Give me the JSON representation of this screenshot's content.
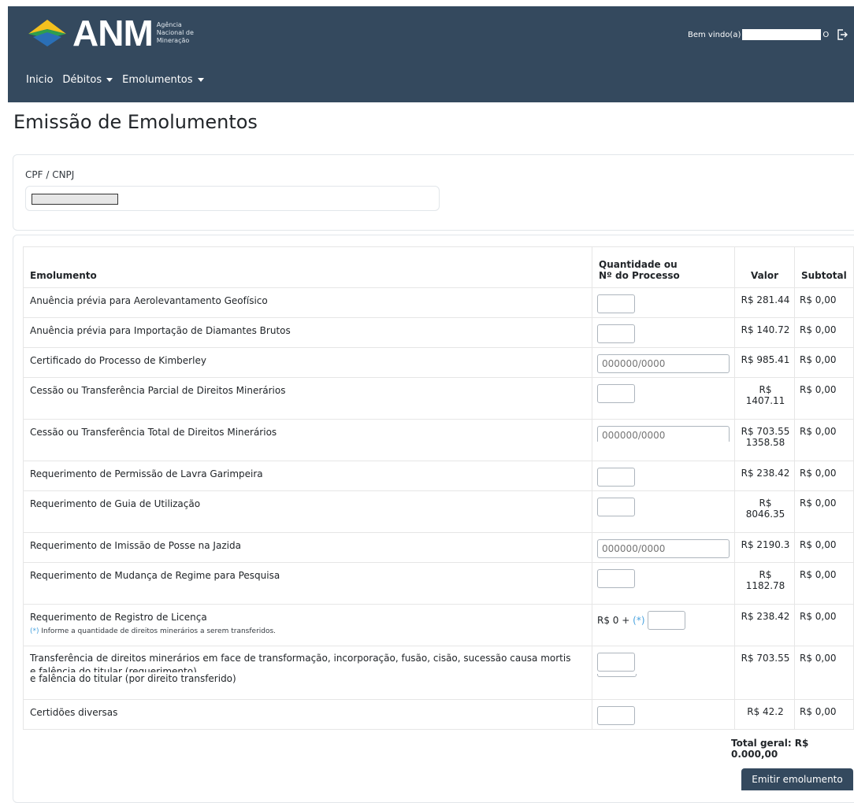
{
  "header": {
    "logo_text": "ANM",
    "logo_sub": [
      "Agência",
      "Nacional de",
      "Mineração"
    ],
    "welcome": "Bem vindo(a)",
    "welcome_tail": "O",
    "nav": [
      "Inicio",
      "Débitos",
      "Emolumentos"
    ],
    "colors": {
      "topbar": "#34495e",
      "logo_yellow": "#f4c01e",
      "logo_green": "#2e9e4f",
      "logo_blue": "#2a6fb6"
    }
  },
  "page": {
    "title": "Emissão de Emolumentos"
  },
  "cpf": {
    "label": "CPF / CNPJ"
  },
  "table": {
    "headers": {
      "emolumento": "Emolumento",
      "qty_line1": "Quantidade ou",
      "qty_line2": "Nº do Processo",
      "valor": "Valor",
      "subtotal": "Subtotal"
    },
    "process_placeholder": "000000/0000",
    "rows": [
      {
        "name": "Anuência prévia para Aerolevantamento Geofísico",
        "valor": "R$ 281.44",
        "subtotal": "R$ 0,00"
      },
      {
        "name": "Anuência prévia para Importação de Diamantes Brutos",
        "valor": "R$ 140.72",
        "subtotal": "R$ 0,00"
      },
      {
        "name": "Certificado do Processo de Kimberley",
        "valor": "R$ 985.41",
        "subtotal": "R$ 0,00"
      },
      {
        "name": "Cessão ou Transferência Parcial de Direitos Minerários",
        "valor_1": "R$",
        "valor_2": "1407.11",
        "subtotal": "R$ 0,00"
      },
      {
        "name": "Cessão ou Transferência Total de Direitos Minerários",
        "valor_1": "R$ 703.55",
        "valor_2": "1358.58",
        "subtotal": "R$ 0,00"
      },
      {
        "name": "Requerimento de Permissão de Lavra Garimpeira",
        "valor": "R$ 238.42",
        "subtotal": "R$ 0,00"
      },
      {
        "name": "Requerimento de Guia de Utilização",
        "valor_1": "R$",
        "valor_2": "8046.35",
        "subtotal": "R$ 0,00"
      },
      {
        "name": "Requerimento de Imissão de Posse na Jazida",
        "valor": "R$ 2190.3",
        "subtotal": "R$ 0,00"
      },
      {
        "name": "Requerimento de Mudança de Regime para Pesquisa",
        "valor_1": "R$",
        "valor_2": "1182.78",
        "subtotal": "R$ 0,00"
      },
      {
        "name": "Requerimento de Registro de Licença",
        "note_ast": "(*)",
        "note": "Informe a quantidade de direitos minerários a serem transferidos.",
        "prefix": "R$ 0 +",
        "prefix_ast": "(*)",
        "valor": "R$ 238.42",
        "subtotal": "R$ 0,00"
      },
      {
        "name_1": "Transferência de direitos minerários em face de transformação, incorporação, fusão, cisão, sucessão causa mortis",
        "name_2": "e falência do titular (requerimento)",
        "name_3": "e falência do titular (por direito transferido)",
        "valor": "R$ 703.55",
        "subtotal": "R$ 0,00"
      },
      {
        "name": "Certidões diversas",
        "valor": "R$ 42.2",
        "subtotal": "R$ 0,00"
      }
    ]
  },
  "footer": {
    "total": "Total geral: R$ 0.000,00",
    "emit_label": "Emitir emolumento"
  }
}
